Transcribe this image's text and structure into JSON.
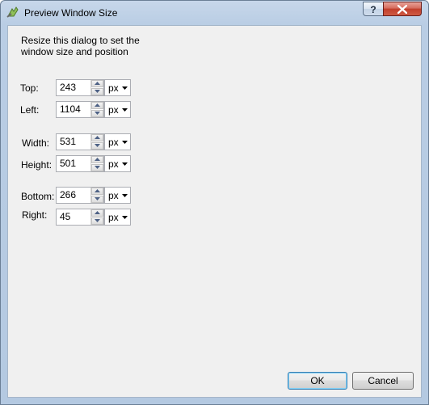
{
  "window": {
    "title": "Preview Window Size",
    "help_label": "?"
  },
  "dialog": {
    "instructions": "Resize this dialog to set the\nwindow size and position",
    "fields": [
      {
        "label": "Top:",
        "value": "243",
        "unit": "px"
      },
      {
        "label": "Left:",
        "value": "1104",
        "unit": "px"
      },
      {
        "label": "Width:",
        "value": "531",
        "unit": "px"
      },
      {
        "label": "Height:",
        "value": "501",
        "unit": "px"
      },
      {
        "label": "Bottom:",
        "value": "266",
        "unit": "px"
      },
      {
        "label": "Right:",
        "value": "45",
        "unit": "px"
      }
    ],
    "ok_label": "OK",
    "cancel_label": "Cancel"
  },
  "icons": {
    "app": "preview-app-icon",
    "help": "help-icon",
    "close": "close-icon",
    "spin_up": "spin-up-arrow-icon",
    "spin_down": "spin-down-arrow-icon",
    "dropdown": "chevron-down-icon"
  },
  "colors": {
    "frame": "#b9cde4",
    "client": "#f0f0f0",
    "close_button": "#c13f2c",
    "default_button_border": "#3c7fb1"
  }
}
